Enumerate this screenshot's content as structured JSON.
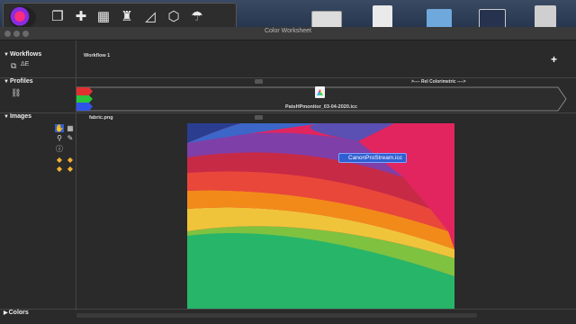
{
  "window": {
    "title": "Color Worksheet"
  },
  "sections": {
    "workflows": {
      "label": "Workflows",
      "name": "Workflow 1"
    },
    "profiles": {
      "label": "Profiles",
      "intent": ">---- Rel Colorimetric ---->",
      "profile_file": "PatsHPmonitor_03-04-2020.icc"
    },
    "images": {
      "label": "Images",
      "file": "fabric.png"
    },
    "colors": {
      "label": "Colors"
    }
  },
  "drag": {
    "label": "CanonProStream.icc"
  },
  "plus": "+",
  "delta_e": "ΔE",
  "icons": {
    "toolbar": [
      "copy-icon",
      "bandage-icon",
      "table-icon",
      "bottle-icon",
      "chart-icon",
      "cube-icon",
      "umbrella-icon"
    ],
    "tools": [
      "hand-icon",
      "grid-icon",
      "zoom-icon",
      "eyedropper-icon",
      "info-icon"
    ]
  }
}
